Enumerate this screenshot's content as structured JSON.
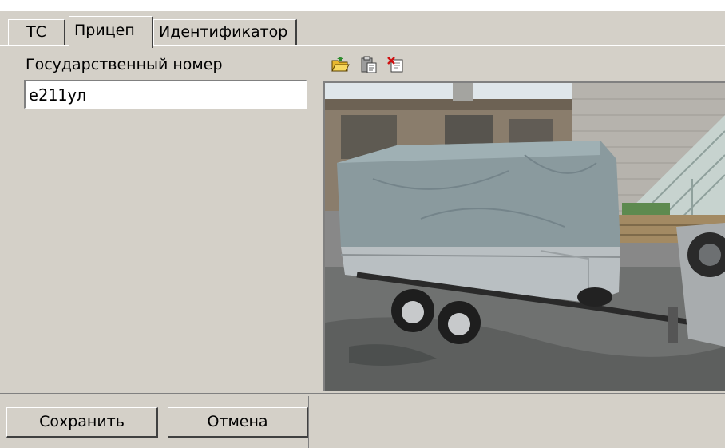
{
  "tabs": [
    {
      "label": "ТС",
      "active": false
    },
    {
      "label": "Прицеп",
      "active": true
    },
    {
      "label": "Идентификатор",
      "active": false
    }
  ],
  "plate": {
    "label": "Государственный номер",
    "value": "е211ул"
  },
  "photo_toolbar": {
    "icons": [
      "open-folder-icon",
      "paste-icon",
      "delete-image-icon"
    ]
  },
  "buttons": {
    "save": "Сохранить",
    "cancel": "Отмена"
  }
}
